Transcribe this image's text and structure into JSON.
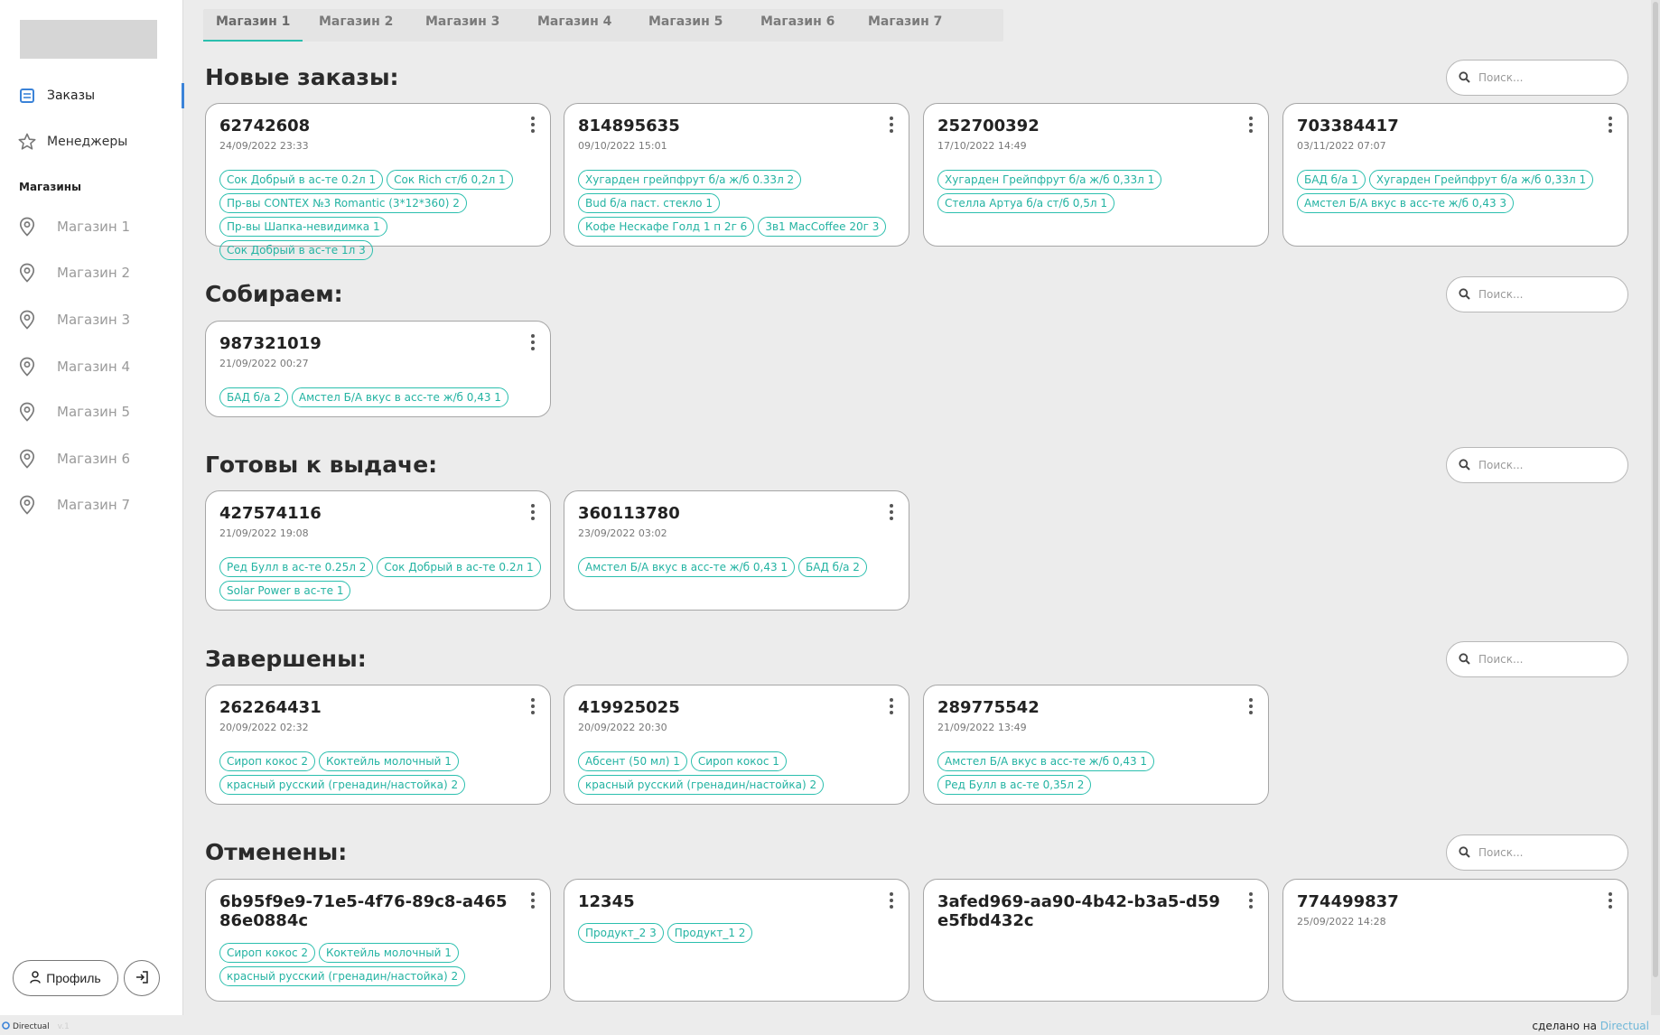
{
  "sidebar": {
    "nav": [
      {
        "label": "Заказы",
        "icon": "list-icon"
      },
      {
        "label": "Менеджеры",
        "icon": "star-icon"
      }
    ],
    "shops_title": "Магазины",
    "shops": [
      "Магазин 1",
      "Магазин 2",
      "Магазин 3",
      "Магазин 4",
      "Магазин 5",
      "Магазин 6",
      "Магазин 7"
    ],
    "profile_label": "Профиль"
  },
  "tabs": [
    "Магазин 1",
    "Магазин 2",
    "Магазин 3",
    "Магазин 4",
    "Магазин 5",
    "Магазин 6",
    "Магазин 7"
  ],
  "active_tab": "Магазин 1",
  "search_placeholder": "Поиск...",
  "sections": [
    {
      "title": "Новые заказы:",
      "cards": [
        {
          "num": "62742608",
          "date": "24/09/2022 23:33",
          "tags": [
            "Сок Добрый в ас-те 0.2л 1",
            "Сок Rich ст/б 0,2л 1",
            "Пр-вы CONTEX №3 Romantic (3*12*360) 2",
            "Пр-вы Шапка-невидимка 1",
            "Сок Добрый в ас-те 1л 3"
          ]
        },
        {
          "num": "814895635",
          "date": "09/10/2022 15:01",
          "tags": [
            "Хугарден грейпфрут б/а ж/б 0.33л 2",
            "Bud б/а паст. стекло 1",
            "Кофе Нескафе Голд 1 п 2г 6",
            "3в1 MacCoffee 20г 3"
          ]
        },
        {
          "num": "252700392",
          "date": "17/10/2022 14:49",
          "tags": [
            "Хугарден Грейпфрут б/а ж/б 0,33л 1",
            "Стелла Артуа б/а ст/б 0,5л 1"
          ]
        },
        {
          "num": "703384417",
          "date": "03/11/2022 07:07",
          "tags": [
            "БАД б/а 1",
            "Хугарден Грейпфрут б/а ж/б 0,33л 1",
            "Амстел Б/А вкус в асс-те ж/б 0,43 3"
          ]
        }
      ]
    },
    {
      "title": "Собираем:",
      "cards": [
        {
          "num": "987321019",
          "date": "21/09/2022 00:27",
          "tags": [
            "БАД б/а 2",
            "Амстел Б/А вкус в асс-те ж/б 0,43 1"
          ]
        }
      ]
    },
    {
      "title": "Готовы к выдаче:",
      "cards": [
        {
          "num": "427574116",
          "date": "21/09/2022 19:08",
          "tags": [
            "Ред Булл в ас-те 0.25л 2",
            "Сок Добрый в ас-те 0.2л 1",
            "Solar Power в ас-те 1"
          ]
        },
        {
          "num": "360113780",
          "date": "23/09/2022 03:02",
          "tags": [
            "Амстел Б/А вкус в асс-те ж/б 0,43 1",
            "БАД б/а 2"
          ]
        }
      ]
    },
    {
      "title": "Завершены:",
      "cards": [
        {
          "num": "262264431",
          "date": "20/09/2022 02:32",
          "tags": [
            "Сироп кокос 2",
            "Коктейль молочный 1",
            "красный русский (гренадин/настойка) 2"
          ]
        },
        {
          "num": "419925025",
          "date": "20/09/2022 20:30",
          "tags": [
            "Абсент (50 мл) 1",
            "Сироп кокос 1",
            "красный русский (гренадин/настойка) 2"
          ]
        },
        {
          "num": "289775542",
          "date": "21/09/2022 13:49",
          "tags": [
            "Амстел Б/А вкус в асс-те ж/б 0,43 1",
            "Ред Булл в ас-те 0,35л 2"
          ]
        }
      ]
    },
    {
      "title": "Отменены:",
      "cards": [
        {
          "num": "6b95f9e9-71e5-4f76-89c8-a46586e0884c",
          "date": "",
          "tags": [
            "Сироп кокос 2",
            "Коктейль молочный 1",
            "красный русский (гренадин/настойка) 2"
          ]
        },
        {
          "num": "12345",
          "date": "",
          "tags": [
            "Продукт_2 3",
            "Продукт_1 2"
          ]
        },
        {
          "num": "3afed969-aa90-4b42-b3a5-d59e5fbd432c",
          "date": "",
          "tags": []
        },
        {
          "num": "774499837",
          "date": "25/09/2022 14:28",
          "tags": []
        }
      ]
    }
  ],
  "footer": {
    "brand": "Directual",
    "version": "v.1",
    "made_with": "сделано на",
    "made_with_brand": "Directual"
  },
  "colors": {
    "accent": "#2bbfae",
    "active_nav": "#3b83d8"
  }
}
